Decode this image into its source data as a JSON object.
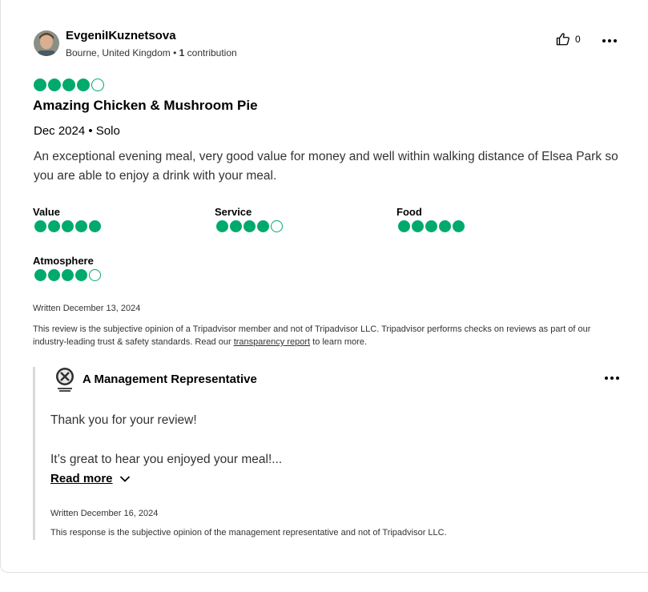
{
  "reviewer": {
    "name": "EvgeniIKuznetsova",
    "location": "Bourne, United Kingdom",
    "separator": " • ",
    "contributions_count": "1",
    "contributions_label": " contribution"
  },
  "helpful": {
    "count": "0"
  },
  "review": {
    "rating": 4,
    "title": "Amazing Chicken & Mushroom Pie",
    "trip": "Dec 2024 • Solo",
    "text": "An exceptional evening meal, very good value for money and well within walking distance of Elsea Park so you are able to enjoy a drink with your meal.",
    "subratings": [
      {
        "label": "Value",
        "rating": 5
      },
      {
        "label": "Service",
        "rating": 4
      },
      {
        "label": "Food",
        "rating": 5
      },
      {
        "label": "Atmosphere",
        "rating": 4
      }
    ],
    "written": "Written December 13, 2024",
    "disclaimer_before": "This review is the subjective opinion of a Tripadvisor member and not of Tripadvisor LLC. Tripadvisor performs checks on reviews as part of our industry-leading trust & safety standards. Read our ",
    "disclaimer_link": "transparency report",
    "disclaimer_after": " to learn more."
  },
  "response": {
    "author": "A Management Representative",
    "line1": "Thank you for your review!",
    "line2": "It’s great to hear you enjoyed your meal!...",
    "read_more": "Read more",
    "written": "Written December 16, 2024",
    "disclaimer": "This response is the subjective opinion of the management representative and not of Tripadvisor LLC."
  },
  "colors": {
    "bubble": "#00aa6c",
    "border": "#e0e0e0"
  },
  "icons": [
    "avatar",
    "thumbs-up-icon",
    "more-options-icon",
    "rating-bubble-icon",
    "management-logo",
    "chevron-down-icon"
  ]
}
